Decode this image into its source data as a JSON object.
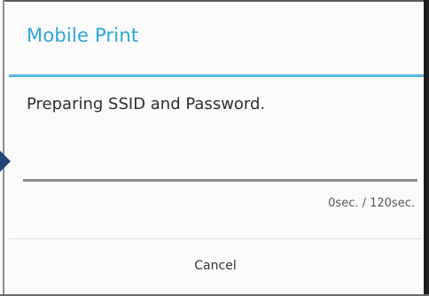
{
  "dialog": {
    "title": "Mobile Print",
    "message": "Preparing SSID and Password.",
    "progress": {
      "fraction": 0,
      "text": "0sec. / 120sec."
    },
    "cancel_label": "Cancel"
  },
  "colors": {
    "title": "#2aa6d6",
    "divider": "#55b9df",
    "arrow": "#23457a"
  },
  "icons": {
    "pointer": "arrow-right-icon"
  }
}
